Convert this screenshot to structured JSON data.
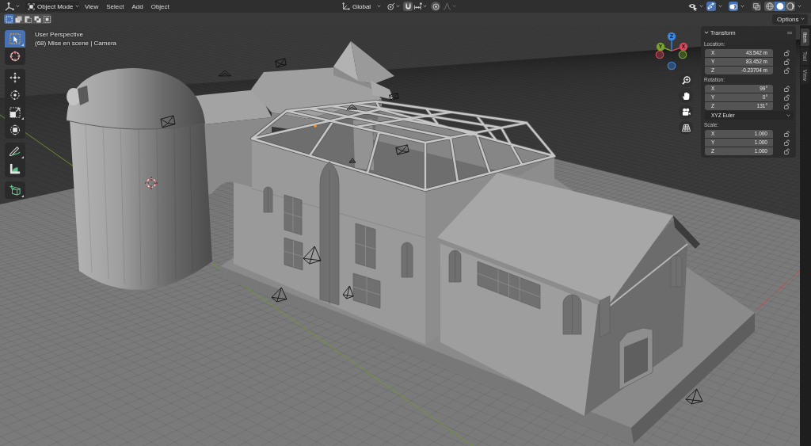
{
  "header": {
    "mode": "Object Mode",
    "menus": [
      "View",
      "Select",
      "Add",
      "Object"
    ],
    "orientation": "Global",
    "snapping": {
      "on": false
    },
    "proportional_editing": {
      "on": false
    },
    "falloff": {
      "disabled": true
    },
    "gizmos": {
      "on": true
    },
    "overlays": {
      "on": true
    },
    "xray": {
      "on": false
    },
    "shading_modes": [
      {
        "kind": "wireframe",
        "selected": false
      },
      {
        "kind": "solid",
        "selected": true
      },
      {
        "kind": "material",
        "selected": false
      }
    ]
  },
  "tool_header": {
    "select_modes": [
      {
        "kind": "new",
        "selected": true
      },
      {
        "kind": "extend",
        "selected": false
      },
      {
        "kind": "subtract",
        "selected": false
      },
      {
        "kind": "difference",
        "selected": false
      },
      {
        "kind": "intersect",
        "selected": false
      }
    ],
    "options": "Options"
  },
  "toolbar": {
    "tool_groups": [
      {
        "tools": [
          {
            "kind": "select_box",
            "selected": true,
            "has_variants": true
          },
          {
            "kind": "cursor",
            "selected": false,
            "has_variants": false
          }
        ]
      },
      {
        "tools": [
          {
            "kind": "move",
            "selected": false,
            "has_variants": false
          },
          {
            "kind": "rotate",
            "selected": false,
            "has_variants": false
          },
          {
            "kind": "scale",
            "selected": false,
            "has_variants": true
          },
          {
            "kind": "transform",
            "selected": false,
            "has_variants": false
          }
        ]
      },
      {
        "tools": [
          {
            "kind": "annotate",
            "selected": false,
            "has_variants": true
          },
          {
            "kind": "measure",
            "selected": false,
            "has_variants": false
          }
        ]
      },
      {
        "tools": [
          {
            "kind": "add_cube",
            "selected": false,
            "has_variants": true
          }
        ]
      }
    ]
  },
  "viewport": {
    "view_name": "User Perspective",
    "info": "(68) Mise en scene | Camera"
  },
  "gizmo": {
    "axes": [
      {
        "label": "Z",
        "color": "#3b87e0"
      },
      {
        "label": "Y",
        "color": "#76a42c"
      },
      {
        "label": "X",
        "color": "#d8465c"
      }
    ]
  },
  "sidebar": {
    "panel": {
      "title": "Transform",
      "expanded": true,
      "sections": [
        {
          "kind": "vector",
          "label": "Location:",
          "fields": [
            {
              "axis": "X",
              "value": "43.542 m",
              "locked": false
            },
            {
              "axis": "Y",
              "value": "83.452 m",
              "locked": false
            },
            {
              "axis": "Z",
              "value": "-0.23704 m",
              "locked": false
            }
          ]
        },
        {
          "kind": "vector",
          "label": "Rotation:",
          "fields": [
            {
              "axis": "X",
              "value": "99°",
              "locked": false
            },
            {
              "axis": "Y",
              "value": "0°",
              "locked": false
            },
            {
              "axis": "Z",
              "value": "131°",
              "locked": false
            }
          ]
        },
        {
          "kind": "dropdown",
          "value": "XYZ Euler"
        },
        {
          "kind": "vector",
          "label": "Scale:",
          "fields": [
            {
              "axis": "X",
              "value": "1.000",
              "locked": false
            },
            {
              "axis": "Y",
              "value": "1.000",
              "locked": false
            },
            {
              "axis": "Z",
              "value": "1.000",
              "locked": false
            }
          ]
        }
      ]
    },
    "tabs": [
      {
        "label": "Item",
        "selected": true
      },
      {
        "label": "Tool",
        "selected": false
      },
      {
        "label": "View",
        "selected": false
      }
    ]
  }
}
